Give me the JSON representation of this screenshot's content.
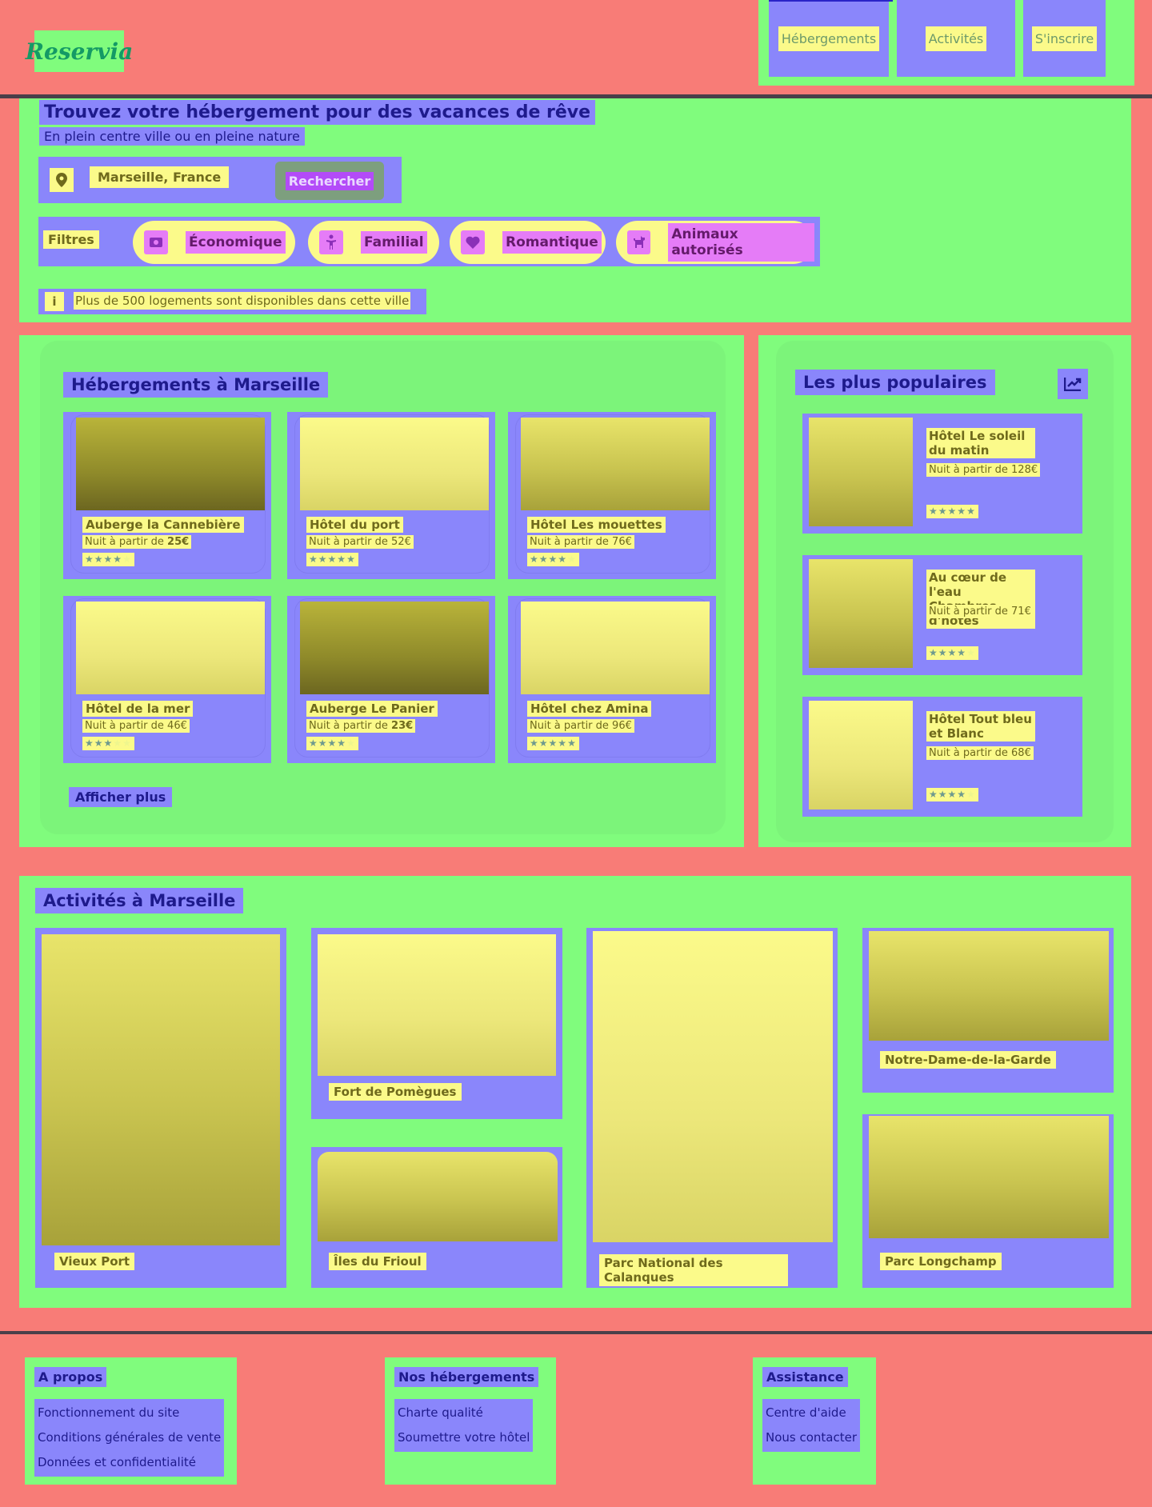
{
  "header": {
    "logo": "Reservia",
    "nav": [
      {
        "label": "Hébergements"
      },
      {
        "label": "Activités"
      },
      {
        "label": "S'inscrire"
      }
    ]
  },
  "hero": {
    "title": "Trouvez votre hébergement pour des vacances de rêve",
    "subtitle": "En plein centre ville ou en pleine nature",
    "search": {
      "city": "Marseille, France",
      "button": "Rechercher",
      "icon": "map-pin-icon"
    },
    "filters": {
      "label": "Filtres",
      "items": [
        {
          "label": "Économique",
          "icon": "money-icon"
        },
        {
          "label": "Familial",
          "icon": "child-icon"
        },
        {
          "label": "Romantique",
          "icon": "heart-icon"
        },
        {
          "label": "Animaux autorisés",
          "icon": "dog-icon"
        }
      ]
    },
    "info": {
      "icon": "info-icon",
      "text": "Plus de 500 logements sont disponibles dans cette ville"
    }
  },
  "accommodations": {
    "title": "Hébergements à Marseille",
    "items": [
      {
        "name": "Auberge la Cannebière",
        "price_prefix": "Nuit à partir de ",
        "price": "25€",
        "rating": 4
      },
      {
        "name": "Hôtel du port",
        "price_prefix": "Nuit à partir de ",
        "price": "52€",
        "rating": 5
      },
      {
        "name": "Hôtel Les mouettes",
        "price_prefix": "Nuit à partir de ",
        "price": "76€",
        "rating": 4
      },
      {
        "name": "Hôtel de la mer",
        "price_prefix": "Nuit à partir de ",
        "price": "46€",
        "rating": 3
      },
      {
        "name": "Auberge Le Panier",
        "price_prefix": "Nuit à partir de ",
        "price": "23€",
        "rating": 4
      },
      {
        "name": "Hôtel chez Amina",
        "price_prefix": "Nuit à partir de ",
        "price": "96€",
        "rating": 5
      }
    ],
    "more": "Afficher plus"
  },
  "popular": {
    "title": "Les plus populaires",
    "icon": "chart-trend-icon",
    "items": [
      {
        "name": "Hôtel Le soleil du matin",
        "price": "Nuit à partir de 128€",
        "rating": 5
      },
      {
        "name": "Au cœur de l'eau Chambres d'hôtes",
        "price": "Nuit à partir de 71€",
        "rating": 4
      },
      {
        "name": "Hôtel Tout bleu et Blanc",
        "price": "Nuit à partir de 68€",
        "rating": 4
      }
    ]
  },
  "activities": {
    "title": "Activités à Marseille",
    "items": [
      {
        "label": "Vieux Port"
      },
      {
        "label": "Fort de Pomègues"
      },
      {
        "label": "Îles du Frioul"
      },
      {
        "label": "Parc National des Calanques"
      },
      {
        "label": "Notre-Dame-de-la-Garde"
      },
      {
        "label": "Parc Longchamp"
      }
    ]
  },
  "footer": {
    "columns": [
      {
        "title": "A propos",
        "links": [
          "Fonctionnement du site",
          "Conditions générales de vente",
          "Données et confidentialité"
        ]
      },
      {
        "title": "Nos hébergements",
        "links": [
          "Charte qualité",
          "Soumettre votre hôtel"
        ]
      },
      {
        "title": "Assistance",
        "links": [
          "Centre d'aide",
          "Nous contacter"
        ]
      }
    ]
  }
}
